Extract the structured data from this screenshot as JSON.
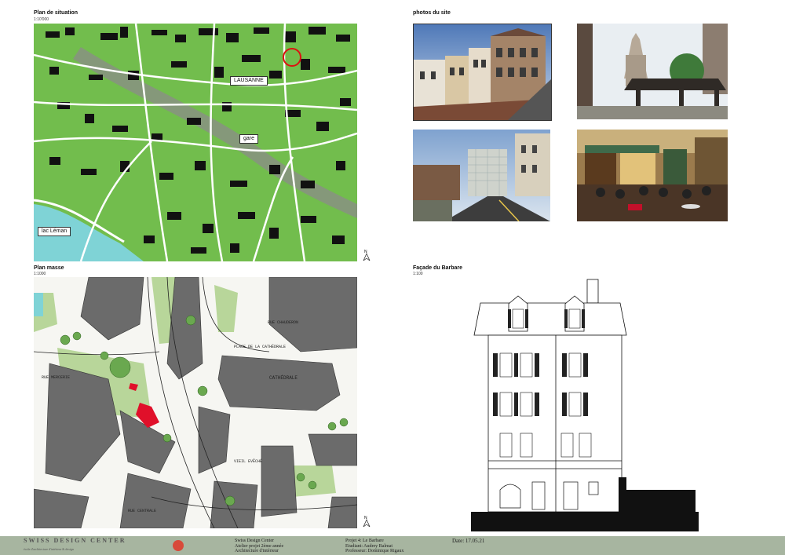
{
  "situation": {
    "title": "Plan de situation",
    "scale": "1:10'000",
    "labels": {
      "lausanne": "LAUSANNE",
      "gare": "gare",
      "lac": "lac Léman"
    }
  },
  "photos": {
    "title": "photos du site"
  },
  "masse": {
    "title": "Plan masse",
    "scale": "1:1000",
    "street_labels": [
      "RUE CHAUDERON",
      "PLACE DE LA CATHÉDRALE",
      "CATHÉDRALE",
      "RUE MERCERIE",
      "RUE CENTRALE",
      "VIEIL EVÊCHÉ"
    ]
  },
  "facade": {
    "title": "Façade du Barbare",
    "scale": "1:100"
  },
  "north_symbol": "N",
  "footer": {
    "school_line1": "Swiss Design Center",
    "school_line2": "Atelier projet 2ème année",
    "school_line3": "Architecture d'intérieur",
    "project_line1": "Projet 4: Le Barbare",
    "project_line2": "Etudiant: Audrey Balmat",
    "project_line3": "Professeur: Dominique Rigaux",
    "date": "Date: 17.05.21",
    "logo_text": "SWISS DESIGN CENTER",
    "logo_sub": "école d'architecture d'intérieur & design"
  },
  "colors": {
    "map_green": "#6fbe4a",
    "water": "#7fd3d6",
    "footer": "#a7b5a0",
    "highlight": "#e0102a"
  }
}
